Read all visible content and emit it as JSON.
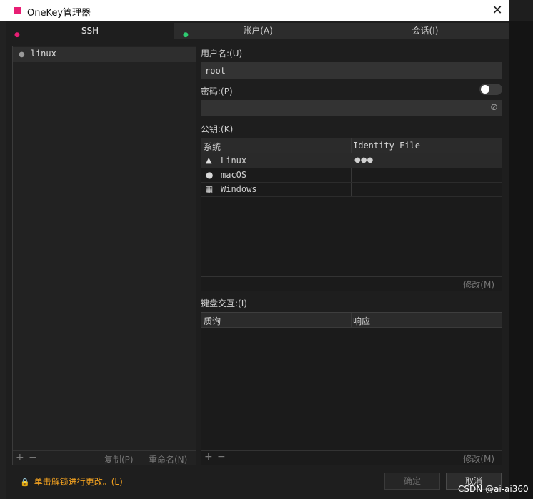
{
  "window": {
    "title": "OneKey管理器",
    "close_glyph": "✕"
  },
  "tabs": [
    {
      "label": "SSH",
      "dot": "●",
      "dot_color": "#e81e74"
    },
    {
      "label": "账户(A)",
      "dot": "●",
      "dot_color": "#2ecc71"
    },
    {
      "label": "会话(I)"
    }
  ],
  "left": {
    "items": [
      {
        "bullet": "●",
        "label": "linux"
      }
    ],
    "footer": {
      "add": "+",
      "remove": "−",
      "copy": "复制(P)",
      "rename": "重命名(N)"
    }
  },
  "form": {
    "username_label": "用户名:(U)",
    "username_value": "root",
    "password_label": "密码:(P)",
    "password_value": "",
    "eye_glyph": "⊘",
    "pubkey_label": "公钥:(K)",
    "keyboard_label": "键盘交互:(I)"
  },
  "pubkey_table": {
    "headers": [
      "系统",
      "Identity File"
    ],
    "rows": [
      {
        "icon": "linux-icon",
        "glyph": "▲",
        "system": "Linux",
        "file": "●●●"
      },
      {
        "icon": "apple-icon",
        "glyph": "●",
        "system": "macOS",
        "file": ""
      },
      {
        "icon": "windows-icon",
        "glyph": "▦",
        "system": "Windows",
        "file": ""
      }
    ],
    "modify": "修改(M)"
  },
  "kb_table": {
    "headers": [
      "质询",
      "响应"
    ],
    "footer": {
      "add": "+",
      "remove": "−",
      "modify": "修改(M)"
    }
  },
  "bottom": {
    "lock_icon": "🔒",
    "lock_text": "单击解锁进行更改。(L)",
    "ok": "确定",
    "cancel": "取消"
  },
  "watermark": "CSDN @ai-ai360",
  "colors": {
    "accent": "#e81e74",
    "lock": "#f0a020",
    "bg": "#1e1e1e"
  }
}
